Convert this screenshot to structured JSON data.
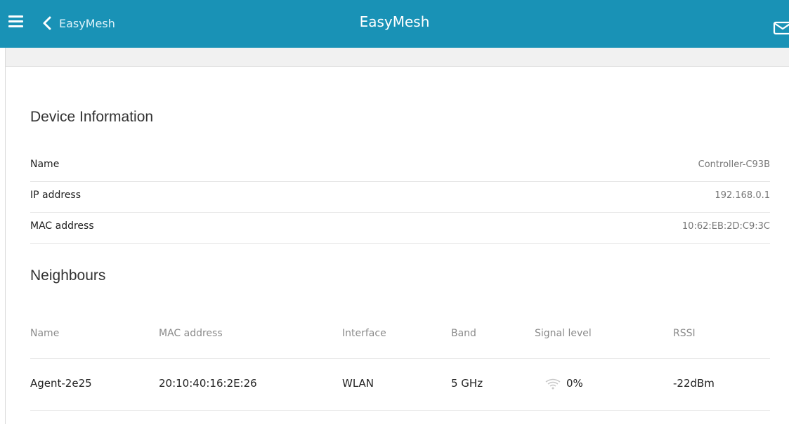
{
  "header": {
    "back_label": "EasyMesh",
    "title": "EasyMesh"
  },
  "device_information": {
    "title": "Device Information",
    "rows": [
      {
        "label": "Name",
        "value": "Controller-C93B"
      },
      {
        "label": "IP address",
        "value": "192.168.0.1"
      },
      {
        "label": "MAC address",
        "value": "10:62:EB:2D:C9:3C"
      }
    ]
  },
  "neighbours": {
    "title": "Neighbours",
    "columns": [
      "Name",
      "MAC address",
      "Interface",
      "Band",
      "Signal level",
      "RSSI"
    ],
    "rows": [
      {
        "name": "Agent-2e25",
        "mac": "20:10:40:16:2E:26",
        "interface": "WLAN",
        "band": "5 GHz",
        "signal": "0%",
        "rssi": "-22dBm"
      }
    ]
  },
  "colors": {
    "header_bg": "#1992b6",
    "subbar_bg": "#f1f1f1"
  },
  "icons": [
    "menu-icon",
    "chevron-left-icon",
    "mail-icon",
    "wifi-signal-icon"
  ]
}
